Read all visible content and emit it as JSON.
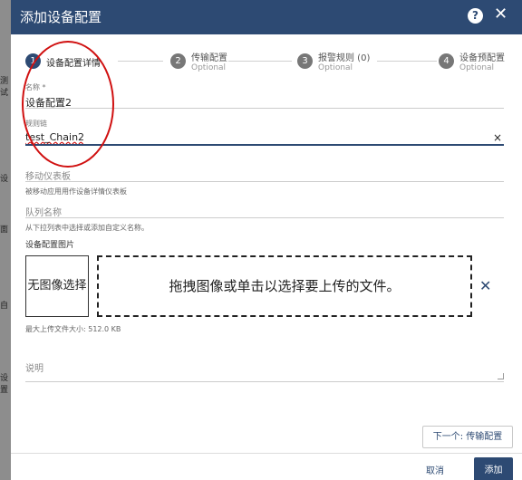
{
  "background": {
    "side_labels": [
      "测试",
      "设",
      "面",
      "自",
      "设置"
    ]
  },
  "dialog": {
    "title": "添加设备配置",
    "help_icon": "?",
    "close_icon": "✕"
  },
  "stepper": {
    "steps": [
      {
        "number": "1",
        "label": "设备配置详情",
        "sub": ""
      },
      {
        "number": "2",
        "label": "传输配置",
        "sub": "Optional"
      },
      {
        "number": "3",
        "label": "报警规则 (0)",
        "sub": "Optional"
      },
      {
        "number": "4",
        "label": "设备预配置",
        "sub": "Optional"
      }
    ]
  },
  "form": {
    "name": {
      "label": "名称 *",
      "value": "设备配置2"
    },
    "rule_chain": {
      "label": "规则链",
      "value": "test_Chain2",
      "clear_icon": "×"
    },
    "mobile_dashboard": {
      "placeholder": "移动仪表板",
      "hint": "被移动应用用作设备详情仪表板"
    },
    "queue": {
      "placeholder": "队列名称",
      "hint": "从下拉列表中选择或添加自定义名称。"
    },
    "image": {
      "label": "设备配置图片",
      "no_image": "无图像选择",
      "dropzone": "拖拽图像或单击以选择要上传的文件。",
      "clear_icon": "✕",
      "max_size": "最大上传文件大小: 512.0 KB"
    },
    "description": {
      "placeholder": "说明"
    }
  },
  "footer": {
    "next": "下一个: 传输配置",
    "cancel": "取消",
    "add": "添加"
  },
  "colors": {
    "primary": "#2d4a73",
    "annotation": "#d01010"
  }
}
